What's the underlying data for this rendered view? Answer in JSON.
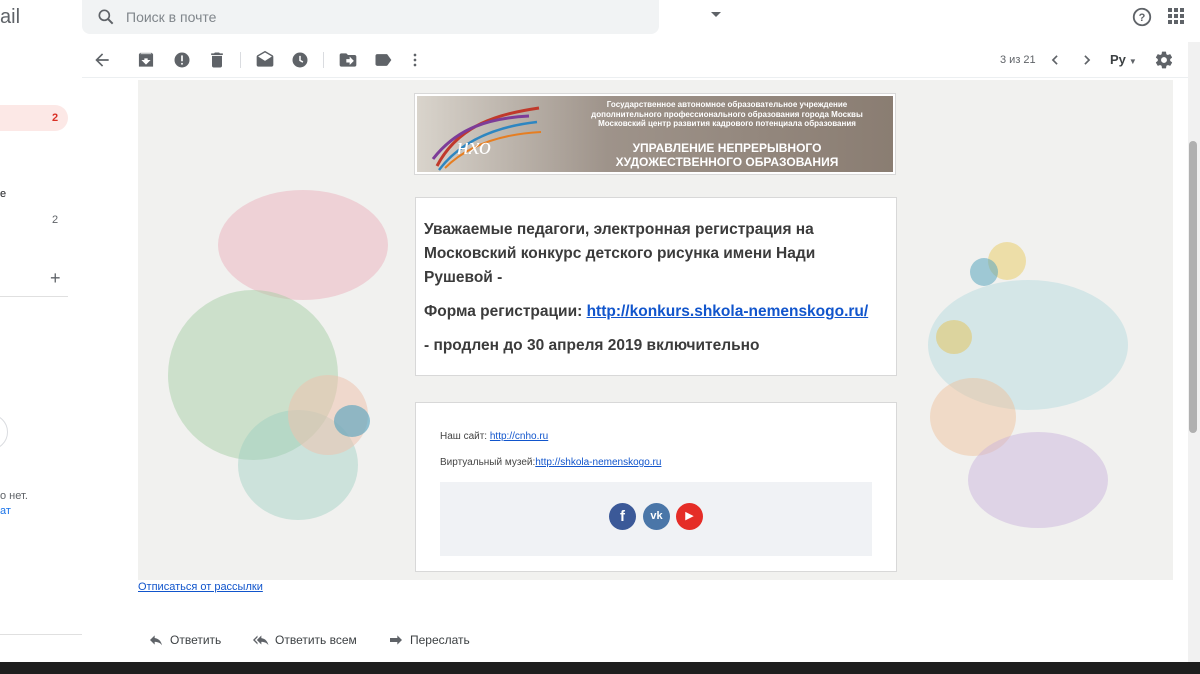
{
  "header": {
    "logo_fragment": "ail",
    "search": {
      "placeholder": "Поиск в почте",
      "value": ""
    }
  },
  "sidebar": {
    "inbox_count": "2",
    "item_fragment": "е",
    "second_count": "2",
    "chat_text_fragment": "о нет.",
    "chat_link_fragment": "ат"
  },
  "toolbar": {
    "pager": "3 из 21",
    "language": "Ру"
  },
  "email": {
    "banner": {
      "logo_text": "нхо",
      "org_line1": "Государственное автономное образовательное учреждение",
      "org_line2": "дополнительного профессионального образования города Москвы",
      "org_line3": "Московский центр развития кадрового потенциала образования",
      "title_line1": "УПРАВЛЕНИЕ НЕПРЕРЫВНОГО",
      "title_line2": "ХУДОЖЕСТВЕННОГО ОБРАЗОВАНИЯ"
    },
    "message": {
      "paragraph1": "Уважаемые педагоги, электронная регистрация на Московский конкурс детского рисунка имени Нади Рушевой -",
      "form_label": "Форма регистрации: ",
      "form_link": "http://konkurs.shkola-nemenskogo.ru/",
      "paragraph3": "- продлен до 30 апреля 2019 включительно"
    },
    "footer": {
      "site_label": "Наш сайт: ",
      "site_link": "http://cnho.ru",
      "museum_label": "Виртуальный музей:",
      "museum_link": "http://shkola-nemenskogo.ru",
      "social": [
        {
          "name": "facebook",
          "glyph": "f",
          "color": "#3b5998"
        },
        {
          "name": "vk",
          "glyph": "vk",
          "color": "#4a76a8"
        },
        {
          "name": "youtube",
          "glyph": "▶",
          "color": "#e52d27"
        }
      ]
    },
    "unsubscribe": "Отписаться от рассылки"
  },
  "actions": {
    "reply": "Ответить",
    "reply_all": "Ответить всем",
    "forward": "Переслать"
  }
}
